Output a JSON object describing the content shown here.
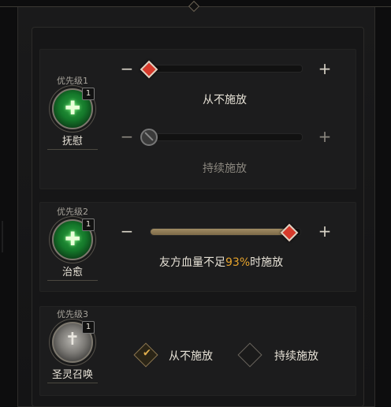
{
  "colors": {
    "accent_gold": "#e6a32c",
    "knob_red": "#d63a2b",
    "fill_tan": "#a08b63"
  },
  "skills": [
    {
      "priority": "优先级1",
      "name": "抚慰",
      "count": "1",
      "icon": "heal-cross-icon",
      "sliders": [
        {
          "minus": "−",
          "plus": "+",
          "label": "从不施放",
          "value": 0.0,
          "enabled": true
        },
        {
          "minus": "−",
          "plus": "+",
          "label": "持续施放",
          "value": 0.0,
          "enabled": false
        }
      ]
    },
    {
      "priority": "优先级2",
      "name": "治愈",
      "count": "1",
      "icon": "group-heal-icon",
      "slider": {
        "minus": "−",
        "plus": "+",
        "value": 0.93,
        "label_prefix": "友方血量不足",
        "label_value": "93%",
        "label_suffix": "时施放"
      }
    },
    {
      "priority": "优先级3",
      "name": "圣灵召唤",
      "count": "1",
      "icon": "holy-summon-icon",
      "options": [
        {
          "label": "从不施放",
          "checked": true
        },
        {
          "label": "持续施放",
          "checked": false
        }
      ]
    }
  ]
}
